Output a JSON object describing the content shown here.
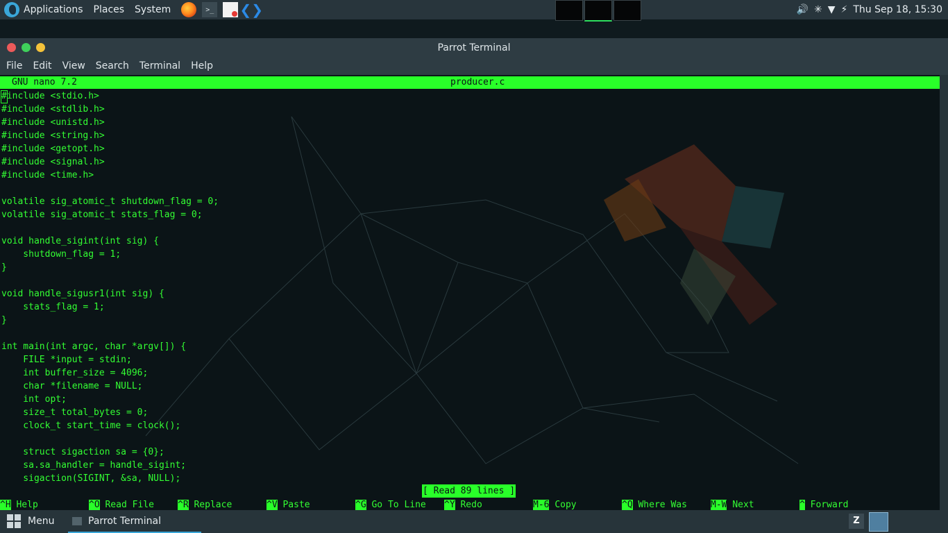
{
  "top_panel": {
    "menu": [
      "Applications",
      "Places",
      "System"
    ],
    "launchers": [
      "firefox-icon",
      "terminal-icon",
      "document-viewer-icon",
      "vscode-icon"
    ],
    "workspaces": 3,
    "clock": "Thu Sep 18, 15:30"
  },
  "window": {
    "title": "Parrot Terminal",
    "menu": [
      "File",
      "Edit",
      "View",
      "Search",
      "Terminal",
      "Help"
    ]
  },
  "nano": {
    "version": "GNU nano 7.2",
    "filename": "producer.c",
    "lines": [
      "#include <stdio.h>",
      "#include <stdlib.h>",
      "#include <unistd.h>",
      "#include <string.h>",
      "#include <getopt.h>",
      "#include <signal.h>",
      "#include <time.h>",
      "",
      "volatile sig_atomic_t shutdown_flag = 0;",
      "volatile sig_atomic_t stats_flag = 0;",
      "",
      "void handle_sigint(int sig) {",
      "    shutdown_flag = 1;",
      "}",
      "",
      "void handle_sigusr1(int sig) {",
      "    stats_flag = 1;",
      "}",
      "",
      "int main(int argc, char *argv[]) {",
      "    FILE *input = stdin;",
      "    int buffer_size = 4096;",
      "    char *filename = NULL;",
      "    int opt;",
      "    size_t total_bytes = 0;",
      "    clock_t start_time = clock();",
      "",
      "    struct sigaction sa = {0};",
      "    sa.sa_handler = handle_sigint;",
      "    sigaction(SIGINT, &sa, NULL);"
    ],
    "status": "[ Read 89 lines ]",
    "shortcuts": [
      {
        "key": "^H",
        "label": "Help"
      },
      {
        "key": "^O",
        "label": "Read File"
      },
      {
        "key": "^R",
        "label": "Replace"
      },
      {
        "key": "^V",
        "label": "Paste"
      },
      {
        "key": "^G",
        "label": "Go To Line"
      },
      {
        "key": "^Y",
        "label": "Redo"
      },
      {
        "key": "M-6",
        "label": "Copy"
      },
      {
        "key": "^Q",
        "label": "Where Was"
      },
      {
        "key": "M-W",
        "label": "Next"
      },
      {
        "key": "^",
        "label": "Forward"
      }
    ]
  },
  "bottom_panel": {
    "menu_label": "Menu",
    "task_label": "Parrot Terminal"
  },
  "colors": {
    "nano_green": "#29ff29",
    "terminal_bg": "#0b1417",
    "panel_bg": "#28353c"
  }
}
